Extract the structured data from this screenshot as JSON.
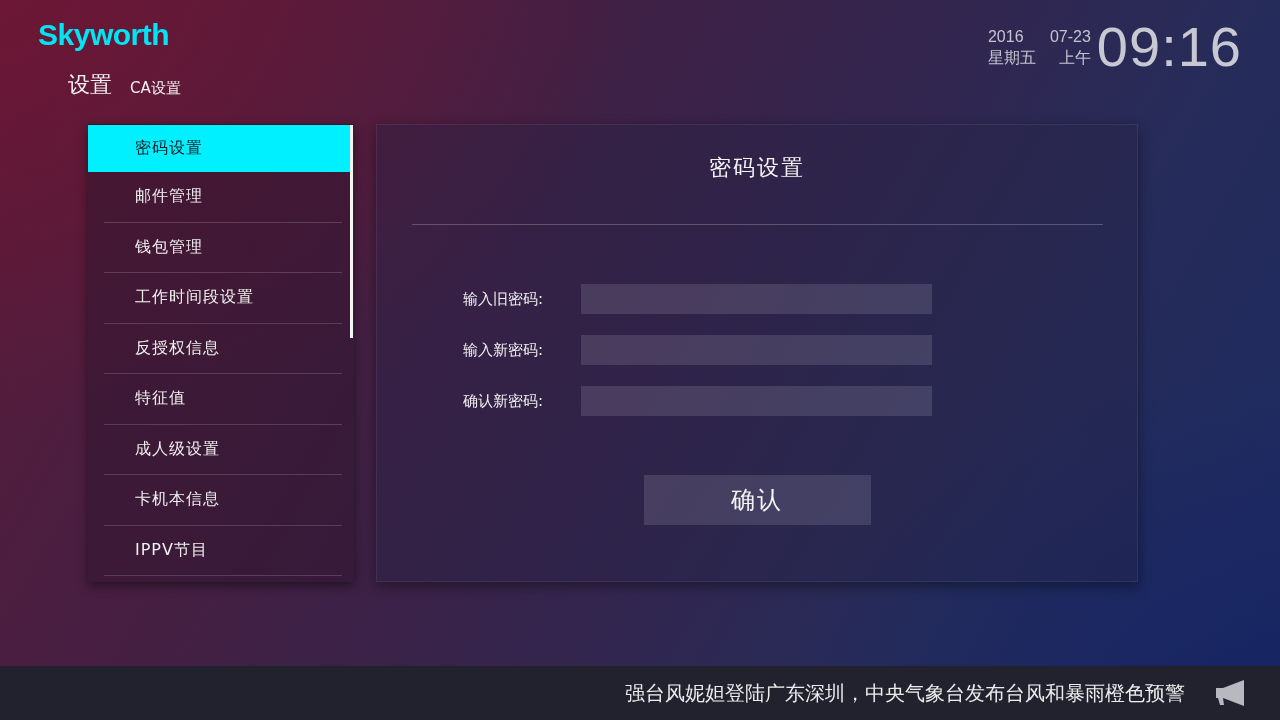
{
  "header": {
    "logo": "Skyworth",
    "clock": {
      "year": "2016",
      "date": "07-23",
      "weekday": "星期五",
      "period": "上午",
      "time": "09:16"
    }
  },
  "breadcrumb": [
    {
      "label": "设置",
      "kind": "section"
    },
    {
      "label": "CA设置",
      "kind": "page"
    }
  ],
  "menu": {
    "items": [
      {
        "label": "密码设置",
        "selected": true
      },
      {
        "label": "邮件管理",
        "selected": false
      },
      {
        "label": "钱包管理",
        "selected": false
      },
      {
        "label": "工作时间段设置",
        "selected": false
      },
      {
        "label": "反授权信息",
        "selected": false
      },
      {
        "label": "特征值",
        "selected": false
      },
      {
        "label": "成人级设置",
        "selected": false
      },
      {
        "label": "卡机本信息",
        "selected": false
      },
      {
        "label": "IPPV节目",
        "selected": false
      }
    ]
  },
  "panel": {
    "title": "密码设置",
    "fields": [
      {
        "label": "输入旧密码:"
      },
      {
        "label": "输入新密码:"
      },
      {
        "label": "确认新密码:"
      }
    ],
    "button": "确认"
  },
  "ticker": {
    "text": "强台风妮妲登陆广东深圳，中央气象台发布台风和暴雨橙色预警"
  }
}
